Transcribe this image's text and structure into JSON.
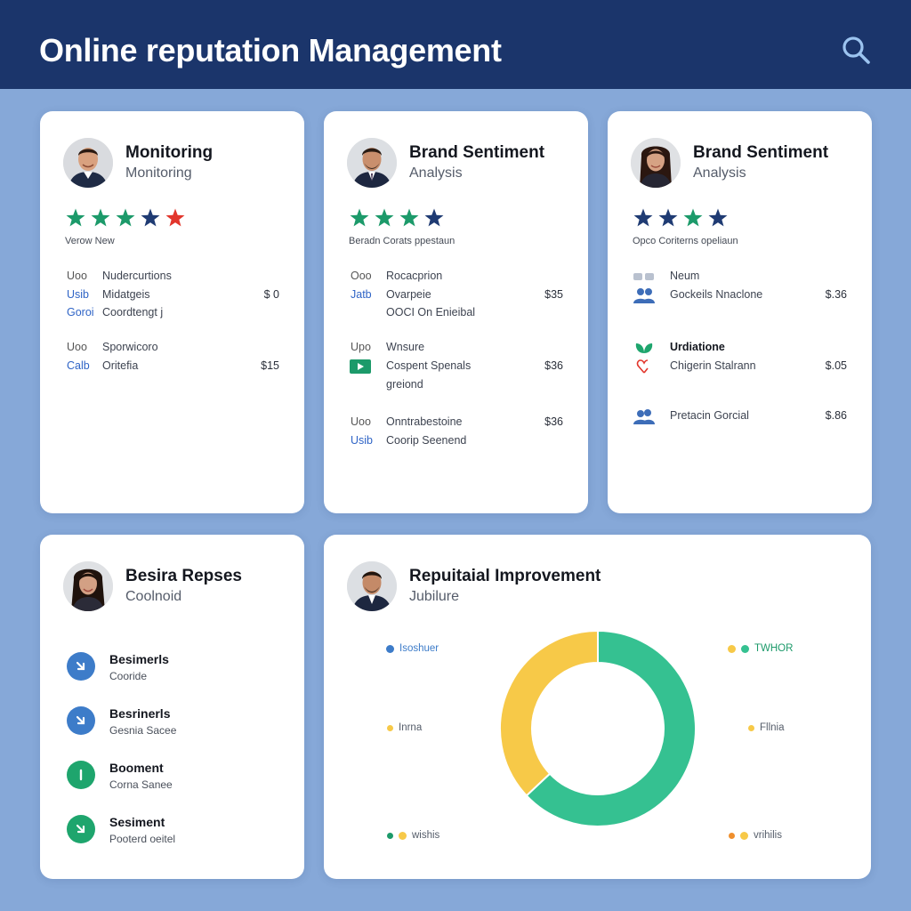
{
  "header": {
    "title": "Online reputation Management",
    "search_icon": "search-icon",
    "background": "#1b356b"
  },
  "colors": {
    "green": "#1c9a6a",
    "navy": "#1f3b73",
    "red": "#e2362c",
    "yellow": "#f7c948",
    "teal": "#35c191",
    "blue": "#3d7cc9"
  },
  "card1": {
    "title": "Monitoring",
    "subtitle": "Monitoring",
    "stars": [
      "green",
      "green",
      "green",
      "navy",
      "red"
    ],
    "caption": "Verow New",
    "rows": [
      {
        "key": "Uoo",
        "text": "Nudercurtions",
        "price": ""
      },
      {
        "key": "Usib",
        "text": "Midatgeis",
        "price": "$ 0"
      },
      {
        "key": "Goroi",
        "text": "Coordtengt j",
        "price": ""
      },
      {
        "key": "Uoo",
        "text": "Sporwicoro",
        "price": ""
      },
      {
        "key": "Calb",
        "text": "Oritefia",
        "price": "$15"
      }
    ]
  },
  "card2": {
    "title": "Brand Sentiment",
    "subtitle": "Analysis",
    "stars": [
      "green",
      "green",
      "green",
      "navy"
    ],
    "caption": "Beradn Corats ppestaun",
    "rows": [
      {
        "key": "Ooo",
        "text": "Rocacprion",
        "price": ""
      },
      {
        "key": "Jatb",
        "text": "Ovarpeie",
        "price": "$35"
      },
      {
        "key": "",
        "text": "OOCI On Enieibal",
        "price": ""
      },
      {
        "key": "Upo",
        "text": "Wnsure",
        "price": ""
      },
      {
        "key": "video-icon",
        "text": "Cospent Spenals",
        "price": "$36"
      },
      {
        "key": "",
        "text": "greiond",
        "price": ""
      },
      {
        "key": "Uoo",
        "text": "Onntrabestoine",
        "price": "$36"
      },
      {
        "key": "Usib",
        "text": "Coorip Seenend",
        "price": ""
      }
    ]
  },
  "card3": {
    "title": "Brand Sentiment",
    "subtitle": "Analysis",
    "stars": [
      "navy",
      "navy",
      "green",
      "navy"
    ],
    "caption": "Opco  Coriterns opeliaun",
    "rows": [
      {
        "key": "link-icon",
        "text": "Neum",
        "price": ""
      },
      {
        "key": "users-icon",
        "text": "Gockeils Nnaclone",
        "price": "$.36"
      },
      {
        "key": "leaf-icon",
        "text": "Urdiatione",
        "price": ""
      },
      {
        "key": "heart-icon",
        "text": "Chigerin Stalrann",
        "price": "$.05"
      },
      {
        "key": "users-icon",
        "text": "Pretacin Gorcial",
        "price": "$.86"
      }
    ]
  },
  "card4": {
    "title": "Besira Repses",
    "subtitle": "Coolnoid",
    "items": [
      {
        "title": "Besimerls",
        "subtitle": "Cooride",
        "color": "#3d7cc9",
        "icon": "arrow-down-right-icon"
      },
      {
        "title": "Besrinerls",
        "subtitle": "Gesnia Sacee",
        "color": "#3d7cc9",
        "icon": "arrow-down-right-icon"
      },
      {
        "title": "Booment",
        "subtitle": "Corna Sanee",
        "color": "#1ea56d",
        "icon": "bar-icon"
      },
      {
        "title": "Sesiment",
        "subtitle": "Pooterd oeitel",
        "color": "#1ea56d",
        "icon": "arrow-down-right-icon"
      }
    ]
  },
  "card5": {
    "title": "Repuitaial Improvement",
    "subtitle": "Jubilure",
    "legend": {
      "top_left": "Isoshuer",
      "top_right": "TWHOR",
      "mid_left": "Inrna",
      "mid_right": "Fllnia",
      "bottom_left": "wishis",
      "bottom_right": "vrihilis"
    },
    "donut": [
      {
        "name": "teal",
        "value": 63
      },
      {
        "name": "yellow",
        "value": 37
      }
    ]
  }
}
